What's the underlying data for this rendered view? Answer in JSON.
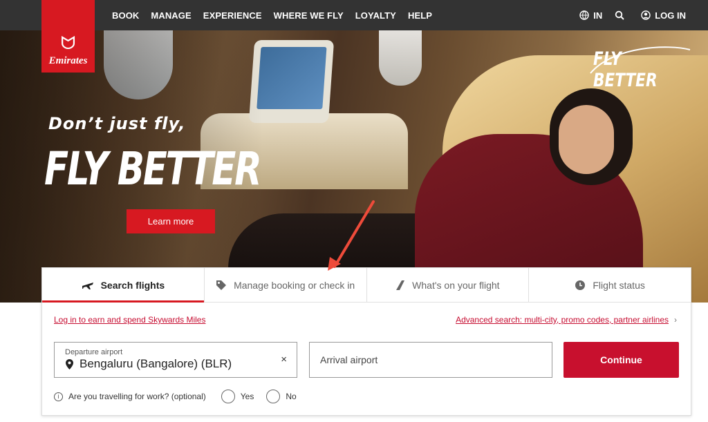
{
  "brand": {
    "name": "Emirates",
    "color": "#d71921",
    "logo_mark": "ᗢ"
  },
  "nav": {
    "items": [
      "BOOK",
      "MANAGE",
      "EXPERIENCE",
      "WHERE WE FLY",
      "LOYALTY",
      "HELP"
    ],
    "region": "IN",
    "login": "LOG IN",
    "icons": {
      "region": "globe-icon",
      "search": "search-icon",
      "login": "user-icon"
    }
  },
  "hero": {
    "tagline": "Don’t just fly,",
    "headline": "FLY BETTER",
    "cta": "Learn more",
    "badge": "FLY BETTER"
  },
  "widget": {
    "tabs": [
      {
        "label": "Search flights",
        "icon": "plane-icon",
        "active": true
      },
      {
        "label": "Manage booking or check in",
        "icon": "tag-icon",
        "active": false
      },
      {
        "label": "What's on your flight",
        "icon": "seat-icon",
        "active": false
      },
      {
        "label": "Flight status",
        "icon": "clock-icon",
        "active": false
      }
    ],
    "skywards_link": "Log in to earn and spend Skywards Miles",
    "advanced_link": "Advanced search: multi-city, promo codes, partner airlines",
    "departure": {
      "label": "Departure airport",
      "value": "Bengaluru (Bangalore) (BLR)",
      "clear": "×"
    },
    "arrival": {
      "placeholder": "Arrival airport"
    },
    "continue": "Continue",
    "work_question": "Are you travelling for work? (optional)",
    "options": [
      "Yes",
      "No"
    ]
  }
}
